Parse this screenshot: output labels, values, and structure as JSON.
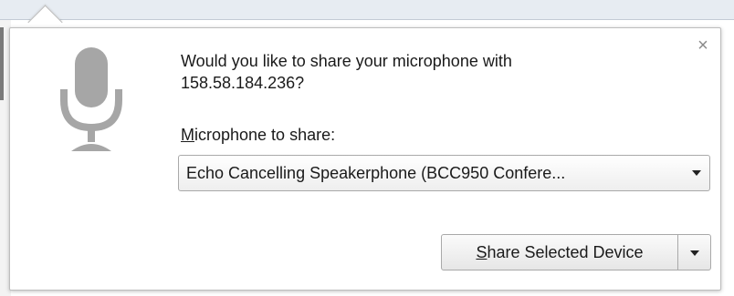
{
  "prompt": {
    "question_line1": "Would you like to share your microphone with",
    "question_line2": "158.58.184.236?",
    "device_label_accesskey": "M",
    "device_label_rest": "icrophone to share:",
    "selected_device": "Echo Cancelling Speakerphone (BCC950 Confere...",
    "share_button_accesskey": "S",
    "share_button_rest": "hare Selected Device",
    "close_symbol": "×"
  },
  "icons": {
    "mic": "microphone-icon",
    "close": "close-icon",
    "select_caret": "chevron-down-icon",
    "button_caret": "chevron-down-icon"
  },
  "colors": {
    "mic_gray": "#a6a6a6",
    "border": "#a9a9a9",
    "text": "#1a1a1a"
  }
}
